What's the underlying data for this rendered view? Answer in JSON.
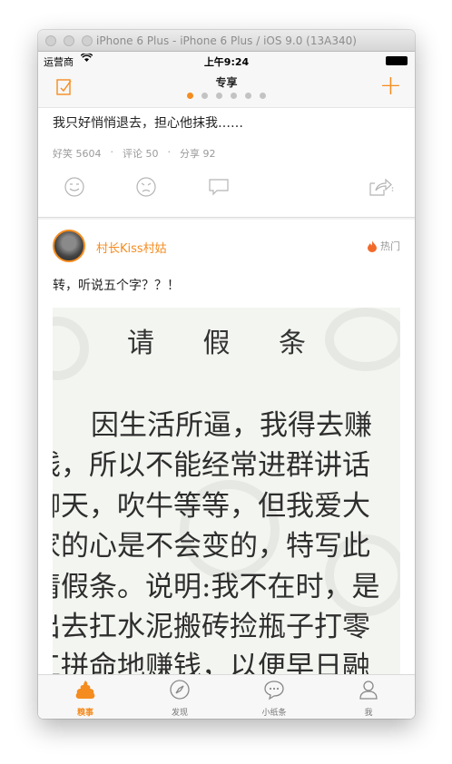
{
  "window": {
    "title": "iPhone 6 Plus - iPhone 6 Plus / iOS 9.0 (13A340)"
  },
  "status_bar": {
    "carrier": "运营商",
    "time": "上午9:24"
  },
  "nav": {
    "title": "专享",
    "page_count": 6,
    "active_page": 0
  },
  "post1": {
    "text": "我只好悄悄退去，担心他抹我……",
    "stats": {
      "funny": "好笑 5604",
      "comments": "评论 50",
      "shares": "分享 92"
    }
  },
  "post2": {
    "username": "村长Kiss村姑",
    "hot_label": "热门",
    "text": "转，听说五个字？？！",
    "image": {
      "title": "请 假 条",
      "lines": [
        "因生活所逼，我得去赚",
        "钱，所以不能经常进群讲话",
        "聊天，吹牛等等，但我爱大",
        "家的心是不会变的，特写此",
        "请假条。说明:我不在时，是",
        "出去扛水泥搬砖捡瓶子打零",
        "工拼命地赚钱，以便早日融"
      ]
    }
  },
  "tabs": [
    {
      "label": "糗事",
      "icon": "poop-icon"
    },
    {
      "label": "发现",
      "icon": "compass-icon"
    },
    {
      "label": "小纸条",
      "icon": "chat-bubble-icon"
    },
    {
      "label": "我",
      "icon": "person-icon"
    }
  ],
  "colors": {
    "accent": "#f58c1f",
    "gray_text": "#9a9a9a"
  }
}
